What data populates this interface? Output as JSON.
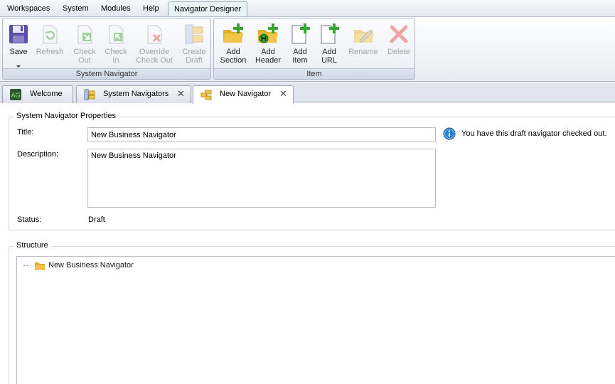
{
  "menu": {
    "workspaces": "Workspaces",
    "system": "System",
    "modules": "Modules",
    "help": "Help",
    "navigator_designer": "Navigator Designer"
  },
  "ribbon": {
    "system_navigator_group": "System Navigator",
    "item_group": "Item",
    "save": "Save",
    "refresh": "Refresh",
    "check_out": "Check\nOut",
    "check_in": "Check\nIn",
    "override_check_out": "Override\nCheck Out",
    "create_draft": "Create\nDraft",
    "add_section": "Add\nSection",
    "add_header": "Add\nHeader",
    "add_item": "Add\nItem",
    "add_url": "Add\nURL",
    "rename": "Rename",
    "delete": "Delete"
  },
  "tabs": {
    "welcome": "Welcome",
    "system_navigators": "System Navigators",
    "new_navigator": "New Navigator",
    "close_glyph": "✕"
  },
  "properties": {
    "legend": "System Navigator Properties",
    "title_label": "Title:",
    "title_value": "New Business Navigator",
    "description_label": "Description:",
    "description_value": "New Business Navigator",
    "status_label": "Status:",
    "status_value": "Draft",
    "info_message": "You have this draft navigator checked out."
  },
  "structure": {
    "legend": "Structure",
    "root_node": "New Business Navigator"
  },
  "colors": {
    "accent_green": "#3aa52e",
    "delete_red": "#e0463c",
    "info_blue": "#2f7fd0",
    "folder_yellow": "#f3c445"
  }
}
